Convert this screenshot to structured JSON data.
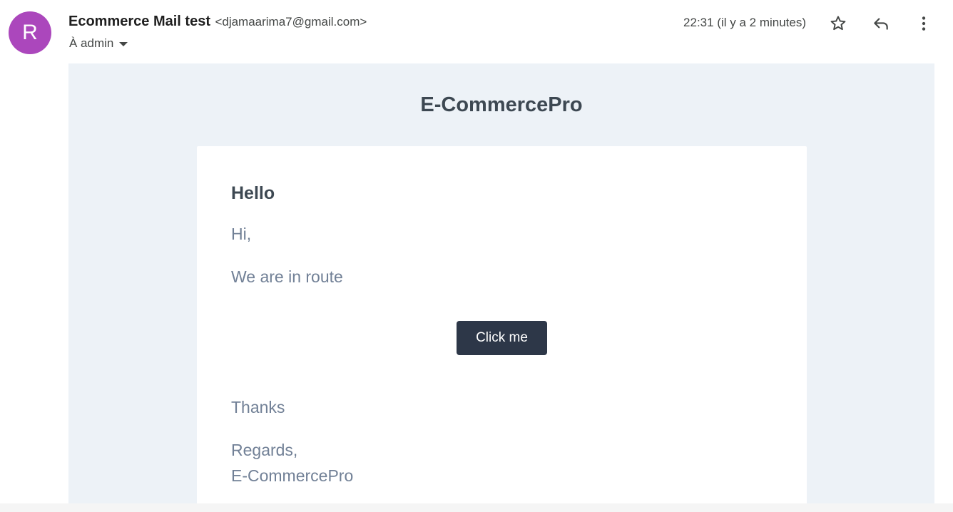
{
  "header": {
    "avatar_letter": "R",
    "avatar_color": "#ab47bc",
    "sender_name": "Ecommerce Mail test",
    "sender_email": "<djamaarima7@gmail.com>",
    "recipient": "À admin",
    "timestamp": "22:31 (il y a 2 minutes)",
    "icons": [
      "star-icon",
      "reply-icon",
      "more-vert-icon"
    ]
  },
  "email": {
    "brand": "E-CommercePro",
    "heading": "Hello",
    "greeting": "Hi,",
    "message": "We are in route",
    "button_label": "Click me",
    "thanks": "Thanks",
    "regards": "Regards,",
    "signature": "E-CommercePro",
    "colors": {
      "body_background": "#edf2f7",
      "button": "#2d3748",
      "heading_text": "#3d4852",
      "paragraph_text": "#718096"
    }
  }
}
